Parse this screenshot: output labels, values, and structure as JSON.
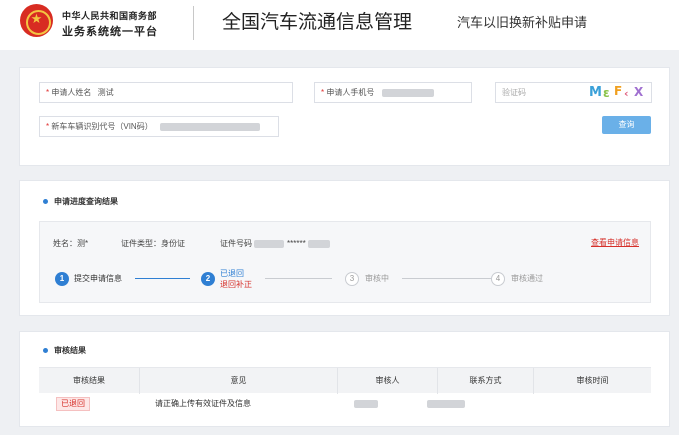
{
  "header": {
    "org_line1": "中华人民共和国商务部",
    "org_line2": "业务系统统一平台",
    "title": "全国汽车流通信息管理",
    "subtitle": "汽车以旧换新补贴申请"
  },
  "form": {
    "name_label": "申请人姓名",
    "name_value": "测试",
    "phone_label": "申请人手机号",
    "captcha_placeholder": "验证码",
    "vin_label": "新车车辆识别代号（VIN码）",
    "query_button": "查询",
    "required_mark": "*"
  },
  "progress": {
    "section_title": "申请进度查询结果",
    "name_text": "姓名：测*",
    "id_type_text": "证件类型：身份证",
    "id_no_label": "证件号码",
    "id_no_masked": "******",
    "view_link": "查看申请信息",
    "steps": [
      {
        "num": "1",
        "label": "提交申请信息",
        "sub": ""
      },
      {
        "num": "2",
        "label": "已退回",
        "sub": "退回补正"
      },
      {
        "num": "3",
        "label": "审核中",
        "sub": ""
      },
      {
        "num": "4",
        "label": "审核通过",
        "sub": ""
      }
    ]
  },
  "result": {
    "section_title": "审核结果",
    "columns": [
      "审核结果",
      "意见",
      "审核人",
      "联系方式",
      "审核时间"
    ],
    "row": {
      "status": "已退回",
      "opinion": "请正确上传有效证件及信息"
    }
  },
  "colors": {
    "accent": "#2f7fd3",
    "danger": "#d6302a",
    "button": "#6ab0e8"
  }
}
